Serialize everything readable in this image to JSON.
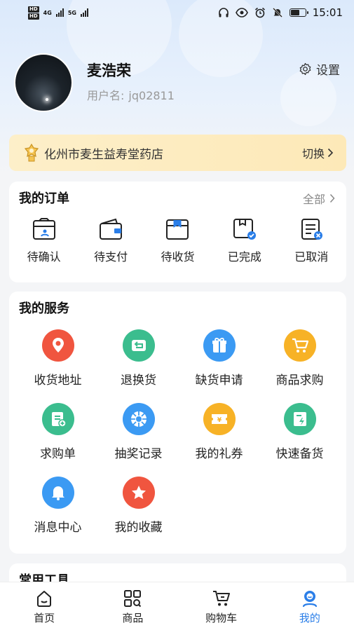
{
  "status_bar": {
    "hd1": "HD",
    "hd2": "HD",
    "net1": "4G",
    "net2": "5G",
    "time": "15:01",
    "battery_level": 0.6
  },
  "profile": {
    "name": "麦浩荣",
    "username_label": "用户名:",
    "username": "jq02811",
    "settings_label": "设置"
  },
  "store": {
    "name": "化州市麦生益寿堂药店",
    "switch_label": "切换"
  },
  "orders": {
    "title": "我的订单",
    "all_label": "全部",
    "items": [
      {
        "label": "待确认",
        "icon": "pending-confirm-icon"
      },
      {
        "label": "待支付",
        "icon": "wallet-icon"
      },
      {
        "label": "待收货",
        "icon": "package-icon"
      },
      {
        "label": "已完成",
        "icon": "completed-icon"
      },
      {
        "label": "已取消",
        "icon": "cancelled-icon"
      }
    ]
  },
  "services": {
    "title": "我的服务",
    "items": [
      {
        "label": "收货地址",
        "icon": "location-icon",
        "color": "#f0553f"
      },
      {
        "label": "退换货",
        "icon": "return-icon",
        "color": "#3bbd8e"
      },
      {
        "label": "缺货申请",
        "icon": "gift-icon",
        "color": "#3b9af3"
      },
      {
        "label": "商品求购",
        "icon": "cart-icon",
        "color": "#f7b226"
      },
      {
        "label": "求购单",
        "icon": "request-list-icon",
        "color": "#3bbd8e"
      },
      {
        "label": "抽奖记录",
        "icon": "lottery-icon",
        "color": "#3b9af3"
      },
      {
        "label": "我的礼券",
        "icon": "coupon-icon",
        "color": "#f7b226"
      },
      {
        "label": "快速备货",
        "icon": "quick-stock-icon",
        "color": "#3bbd8e"
      },
      {
        "label": "消息中心",
        "icon": "bell-icon",
        "color": "#3b9af3"
      },
      {
        "label": "我的收藏",
        "icon": "star-icon",
        "color": "#f0553f"
      }
    ]
  },
  "tools": {
    "title": "常用工具"
  },
  "tabbar": {
    "active_color": "#2a7ee8",
    "items": [
      {
        "label": "首页",
        "icon": "home-icon"
      },
      {
        "label": "商品",
        "icon": "grid-search-icon"
      },
      {
        "label": "购物车",
        "icon": "shopping-cart-icon"
      },
      {
        "label": "我的",
        "icon": "profile-icon",
        "active": true
      }
    ]
  }
}
